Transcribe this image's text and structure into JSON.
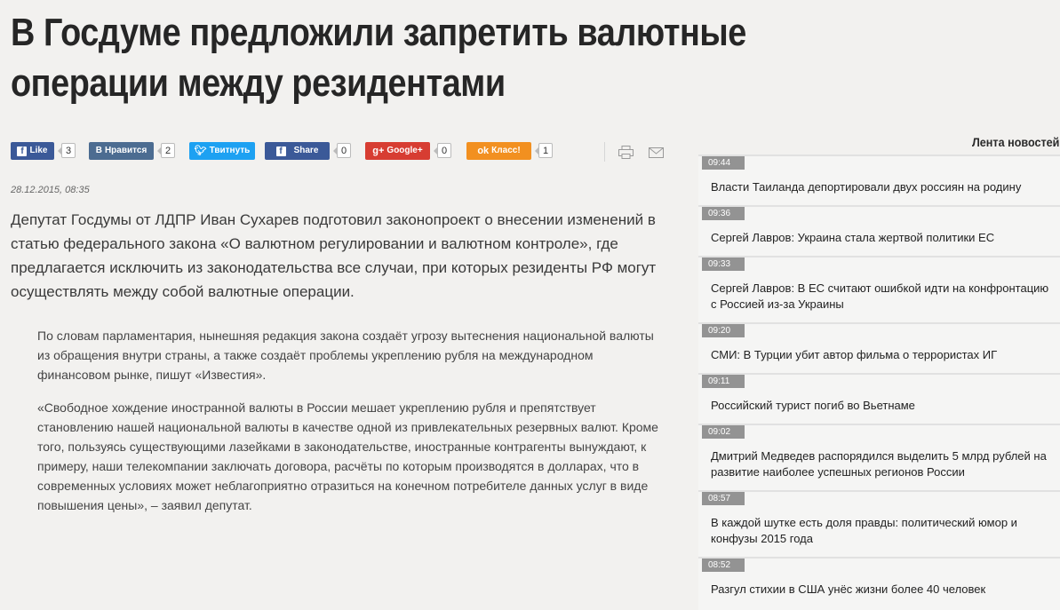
{
  "article": {
    "title": "В Госдуме предложили запретить валютные операции между резидентами",
    "date": "28.12.2015, 08:35",
    "lead": "Депутат Госдумы от ЛДПР Иван Сухарев подготовил законопроект о внесении изменений в статью федерального закона «О валютном регулировании и валютном контроле», где предлагается исключить из законодательства все случаи, при которых резиденты РФ могут осуществлять между собой валютные операции.",
    "quote1": "По словам парламентария, нынешняя редакция закона создаёт угрозу вытеснения национальной валюты из обращения внутри страны, а также создаёт проблемы укреплению рубля на международном финансовом рынке, пишут «Известия».",
    "quote2": "«Свободное хождение иностранной валюты в России мешает укреплению рубля и препятствует становлению нашей национальной валюты в качестве одной из привлекательных резервных валют. Кроме того, пользуясь существующими лазейками в законодательстве, иностранные контрагенты вынуждают, к примеру, наши телекомпании заключать договора, расчёты по которым производятся в долларах, что в современных условиях может неблагоприятно отразиться на конечном потребителе данных услуг в виде повышения цены», – заявил депутат."
  },
  "share": {
    "facebook_like": {
      "label": "Like",
      "count": "3",
      "color": "#3b5998"
    },
    "vk": {
      "label": "Нравится",
      "count": "2",
      "color": "#4c6c91"
    },
    "twitter": {
      "label": "Твитнуть",
      "count": "",
      "color": "#1da1f2"
    },
    "facebook_share": {
      "label": "Share",
      "count": "0",
      "color": "#3b5998"
    },
    "google": {
      "label": "Google+",
      "count": "0",
      "color": "#d73d32"
    },
    "ok": {
      "label": "Класс!",
      "count": "1",
      "color": "#f29020"
    }
  },
  "tools": {
    "print_icon": "printer-icon",
    "mail_icon": "envelope-icon"
  },
  "feed": {
    "title": "Лента новостей",
    "items": [
      {
        "time": "09:44",
        "text": "Власти Таиланда депортировали двух россиян на родину"
      },
      {
        "time": "09:36",
        "text": "Сергей Лавров: Украина стала жертвой политики ЕС"
      },
      {
        "time": "09:33",
        "text": "Сергей Лавров: В ЕС считают ошибкой идти на конфронтацию с Россией из-за Украины"
      },
      {
        "time": "09:20",
        "text": "СМИ: В Турции убит автор фильма о террористах ИГ"
      },
      {
        "time": "09:11",
        "text": "Российский турист погиб во Вьетнаме"
      },
      {
        "time": "09:02",
        "text": "Дмитрий Медведев распорядился выделить 5 млрд рублей на развитие наиболее успешных регионов России"
      },
      {
        "time": "08:57",
        "text": "В каждой шутке есть доля правды: политический юмор и конфузы 2015 года"
      },
      {
        "time": "08:52",
        "text": "Разгул стихии в США унёс жизни более 40 человек"
      }
    ]
  }
}
